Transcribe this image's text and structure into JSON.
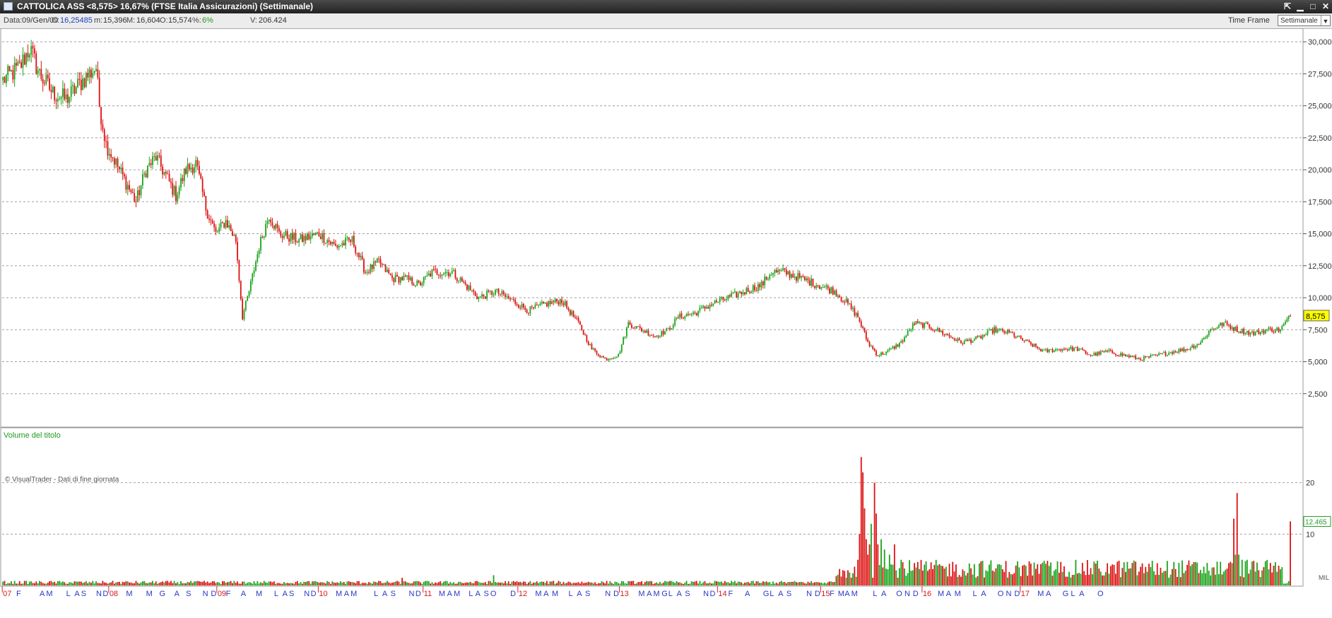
{
  "window": {
    "title": "CATTOLICA ASS <8,575> 16,67%  (FTSE Italia Assicurazioni)  (Settimanale)",
    "buttons": [
      "⇱",
      "▁",
      "□",
      "✕"
    ]
  },
  "infobar": {
    "data_label": "Data:",
    "data_value": "09/Gen/09",
    "c_label": "C:",
    "c_value": "16,25485",
    "m_label": "m:",
    "m_value": "15,396",
    "M_label": "M:",
    "M_value": "16,604",
    "o_label": "O:",
    "o_value": "15,574",
    "pct_label": "%:",
    "pct_value": "6%",
    "v_label": "V:",
    "v_value": "206.424",
    "timeframe_label": "Time Frame",
    "timeframe_value": "Settimanale"
  },
  "colors": {
    "up": "#1aa31a",
    "down": "#dd1111",
    "grid": "#a0a0a0",
    "axis_text": "#333333",
    "last_price_bg": "#ffff00"
  },
  "chart_data": [
    {
      "type": "candlestick",
      "ylim": [
        0,
        31000
      ],
      "yticks": [
        "2,500",
        "5,000",
        "7,500",
        "10,000",
        "12,500",
        "15,000",
        "17,500",
        "20,000",
        "22,500",
        "25,000",
        "27,500",
        "30,000"
      ],
      "last_price": "8,575",
      "watermark": "© VisualTrader - Dati di fine giornata",
      "grid": true,
      "anchors": [
        [
          0,
          27.0
        ],
        [
          10,
          28.0
        ],
        [
          16,
          29.5
        ],
        [
          22,
          27.5
        ],
        [
          30,
          26.0
        ],
        [
          38,
          25.5
        ],
        [
          48,
          27.0
        ],
        [
          56,
          28.0
        ],
        [
          58,
          25.0
        ],
        [
          62,
          22.0
        ],
        [
          68,
          20.5
        ],
        [
          74,
          19.0
        ],
        [
          80,
          17.5
        ],
        [
          86,
          20.0
        ],
        [
          92,
          21.0
        ],
        [
          98,
          19.5
        ],
        [
          104,
          18.0
        ],
        [
          110,
          20.0
        ],
        [
          116,
          20.5
        ],
        [
          122,
          17.0
        ],
        [
          128,
          15.0
        ],
        [
          134,
          16.0
        ],
        [
          140,
          14.5
        ],
        [
          144,
          8.5
        ],
        [
          148,
          10.5
        ],
        [
          154,
          14.0
        ],
        [
          160,
          16.5
        ],
        [
          166,
          15.0
        ],
        [
          178,
          14.5
        ],
        [
          190,
          15.0
        ],
        [
          200,
          14.0
        ],
        [
          210,
          14.5
        ],
        [
          218,
          12.0
        ],
        [
          226,
          12.8
        ],
        [
          234,
          11.5
        ],
        [
          242,
          11.5
        ],
        [
          250,
          11.0
        ],
        [
          258,
          12.0
        ],
        [
          270,
          12.0
        ],
        [
          278,
          11.0
        ],
        [
          286,
          10.0
        ],
        [
          296,
          10.5
        ],
        [
          306,
          9.8
        ],
        [
          316,
          9.0
        ],
        [
          326,
          9.5
        ],
        [
          336,
          9.8
        ],
        [
          346,
          8.0
        ],
        [
          354,
          6.0
        ],
        [
          362,
          5.2
        ],
        [
          370,
          5.5
        ],
        [
          376,
          8.0
        ],
        [
          384,
          7.5
        ],
        [
          392,
          7.0
        ],
        [
          400,
          7.5
        ],
        [
          406,
          8.5
        ],
        [
          416,
          8.8
        ],
        [
          426,
          9.5
        ],
        [
          436,
          10.0
        ],
        [
          446,
          10.5
        ],
        [
          456,
          11.0
        ],
        [
          462,
          12.0
        ],
        [
          470,
          12.0
        ],
        [
          480,
          11.5
        ],
        [
          490,
          11.0
        ],
        [
          500,
          10.5
        ],
        [
          508,
          9.5
        ],
        [
          514,
          8.5
        ],
        [
          520,
          6.5
        ],
        [
          526,
          5.5
        ],
        [
          532,
          5.8
        ],
        [
          540,
          6.5
        ],
        [
          548,
          8.0
        ],
        [
          556,
          7.8
        ],
        [
          566,
          7.2
        ],
        [
          576,
          6.5
        ],
        [
          586,
          6.8
        ],
        [
          596,
          7.5
        ],
        [
          606,
          7.2
        ],
        [
          616,
          6.5
        ],
        [
          626,
          5.8
        ],
        [
          636,
          6.0
        ],
        [
          646,
          6.0
        ],
        [
          654,
          5.5
        ],
        [
          664,
          5.8
        ],
        [
          674,
          5.5
        ],
        [
          684,
          5.2
        ],
        [
          694,
          5.5
        ],
        [
          704,
          5.8
        ],
        [
          712,
          6.0
        ],
        [
          720,
          6.5
        ],
        [
          726,
          7.5
        ],
        [
          734,
          8.0
        ],
        [
          742,
          7.5
        ],
        [
          752,
          7.2
        ],
        [
          760,
          7.5
        ],
        [
          768,
          7.5
        ],
        [
          774,
          8.575
        ]
      ],
      "x_labels": [
        {
          "t": "07",
          "r": 0,
          "c": "red"
        },
        {
          "t": "F",
          "r": 8,
          "c": "blue"
        },
        {
          "t": "A",
          "r": 22,
          "c": "blue"
        },
        {
          "t": "M",
          "r": 26,
          "c": "blue"
        },
        {
          "t": "L",
          "r": 38,
          "c": "blue"
        },
        {
          "t": "A",
          "r": 43,
          "c": "blue"
        },
        {
          "t": "S",
          "r": 47,
          "c": "blue"
        },
        {
          "t": "N",
          "r": 56,
          "c": "blue"
        },
        {
          "t": "D",
          "r": 60,
          "c": "blue"
        },
        {
          "t": "08",
          "r": 64,
          "c": "red"
        },
        {
          "t": "M",
          "r": 74,
          "c": "blue"
        },
        {
          "t": "M",
          "r": 86,
          "c": "blue"
        },
        {
          "t": "G",
          "r": 94,
          "c": "blue"
        },
        {
          "t": "A",
          "r": 103,
          "c": "blue"
        },
        {
          "t": "S",
          "r": 110,
          "c": "blue"
        },
        {
          "t": "N",
          "r": 120,
          "c": "blue"
        },
        {
          "t": "D",
          "r": 125,
          "c": "blue"
        },
        {
          "t": "09",
          "r": 129,
          "c": "red"
        },
        {
          "t": "F",
          "r": 134,
          "c": "blue"
        },
        {
          "t": "A",
          "r": 143,
          "c": "blue"
        },
        {
          "t": "M",
          "r": 152,
          "c": "blue"
        },
        {
          "t": "L",
          "r": 163,
          "c": "blue"
        },
        {
          "t": "A",
          "r": 168,
          "c": "blue"
        },
        {
          "t": "S",
          "r": 172,
          "c": "blue"
        },
        {
          "t": "N",
          "r": 181,
          "c": "blue"
        },
        {
          "t": "D",
          "r": 185,
          "c": "blue"
        },
        {
          "t": "10",
          "r": 190,
          "c": "red"
        },
        {
          "t": "M",
          "r": 200,
          "c": "blue"
        },
        {
          "t": "A",
          "r": 205,
          "c": "blue"
        },
        {
          "t": "M",
          "r": 209,
          "c": "blue"
        },
        {
          "t": "L",
          "r": 223,
          "c": "blue"
        },
        {
          "t": "A",
          "r": 228,
          "c": "blue"
        },
        {
          "t": "S",
          "r": 233,
          "c": "blue"
        },
        {
          "t": "N",
          "r": 244,
          "c": "blue"
        },
        {
          "t": "D",
          "r": 248,
          "c": "blue"
        },
        {
          "t": "11",
          "r": 253,
          "c": "red"
        },
        {
          "t": "M",
          "r": 262,
          "c": "blue"
        },
        {
          "t": "A",
          "r": 267,
          "c": "blue"
        },
        {
          "t": "M",
          "r": 271,
          "c": "blue"
        },
        {
          "t": "L",
          "r": 280,
          "c": "blue"
        },
        {
          "t": "A",
          "r": 284,
          "c": "blue"
        },
        {
          "t": "S",
          "r": 289,
          "c": "blue"
        },
        {
          "t": "O",
          "r": 293,
          "c": "blue"
        },
        {
          "t": "D",
          "r": 305,
          "c": "blue"
        },
        {
          "t": "12",
          "r": 310,
          "c": "red"
        },
        {
          "t": "M",
          "r": 320,
          "c": "blue"
        },
        {
          "t": "A",
          "r": 325,
          "c": "blue"
        },
        {
          "t": "M",
          "r": 330,
          "c": "blue"
        },
        {
          "t": "L",
          "r": 340,
          "c": "blue"
        },
        {
          "t": "A",
          "r": 345,
          "c": "blue"
        },
        {
          "t": "S",
          "r": 350,
          "c": "blue"
        },
        {
          "t": "N",
          "r": 362,
          "c": "blue"
        },
        {
          "t": "D",
          "r": 367,
          "c": "blue"
        },
        {
          "t": "13",
          "r": 371,
          "c": "red"
        },
        {
          "t": "M",
          "r": 382,
          "c": "blue"
        },
        {
          "t": "A",
          "r": 387,
          "c": "blue"
        },
        {
          "t": "M",
          "r": 391,
          "c": "blue"
        },
        {
          "t": "G",
          "r": 396,
          "c": "blue"
        },
        {
          "t": "L",
          "r": 400,
          "c": "blue"
        },
        {
          "t": "A",
          "r": 405,
          "c": "blue"
        },
        {
          "t": "S",
          "r": 410,
          "c": "blue"
        },
        {
          "t": "N",
          "r": 421,
          "c": "blue"
        },
        {
          "t": "D",
          "r": 425,
          "c": "blue"
        },
        {
          "t": "14",
          "r": 430,
          "c": "red"
        },
        {
          "t": "F",
          "r": 436,
          "c": "blue"
        },
        {
          "t": "A",
          "r": 446,
          "c": "blue"
        },
        {
          "t": "G",
          "r": 457,
          "c": "blue"
        },
        {
          "t": "L",
          "r": 461,
          "c": "blue"
        },
        {
          "t": "A",
          "r": 466,
          "c": "blue"
        },
        {
          "t": "S",
          "r": 471,
          "c": "blue"
        },
        {
          "t": "N",
          "r": 483,
          "c": "blue"
        },
        {
          "t": "D",
          "r": 488,
          "c": "blue"
        },
        {
          "t": "15",
          "r": 492,
          "c": "red"
        },
        {
          "t": "F",
          "r": 497,
          "c": "blue"
        },
        {
          "t": "M",
          "r": 502,
          "c": "blue"
        },
        {
          "t": "A",
          "r": 506,
          "c": "blue"
        },
        {
          "t": "M",
          "r": 510,
          "c": "blue"
        },
        {
          "t": "L",
          "r": 523,
          "c": "blue"
        },
        {
          "t": "A",
          "r": 528,
          "c": "blue"
        },
        {
          "t": "O",
          "r": 537,
          "c": "blue"
        },
        {
          "t": "N",
          "r": 542,
          "c": "blue"
        },
        {
          "t": "D",
          "r": 547,
          "c": "blue"
        },
        {
          "t": "16",
          "r": 553,
          "c": "red"
        },
        {
          "t": "M",
          "r": 562,
          "c": "blue"
        },
        {
          "t": "A",
          "r": 567,
          "c": "blue"
        },
        {
          "t": "M",
          "r": 572,
          "c": "blue"
        },
        {
          "t": "L",
          "r": 583,
          "c": "blue"
        },
        {
          "t": "A",
          "r": 588,
          "c": "blue"
        },
        {
          "t": "O",
          "r": 598,
          "c": "blue"
        },
        {
          "t": "N",
          "r": 603,
          "c": "blue"
        },
        {
          "t": "D",
          "r": 608,
          "c": "blue"
        },
        {
          "t": "17",
          "r": 612,
          "c": "red"
        },
        {
          "t": "M",
          "r": 622,
          "c": "blue"
        },
        {
          "t": "A",
          "r": 627,
          "c": "blue"
        },
        {
          "t": "G",
          "r": 637,
          "c": "blue"
        },
        {
          "t": "L",
          "r": 642,
          "c": "blue"
        },
        {
          "t": "A",
          "r": 647,
          "c": "blue"
        },
        {
          "t": "O",
          "r": 658,
          "c": "blue"
        }
      ]
    },
    {
      "type": "bar",
      "title": "Volume del titolo",
      "ylim": [
        0,
        30
      ],
      "yticks": [
        "10",
        "20"
      ],
      "unit": "MIL",
      "last_value": "12.465",
      "baseline_volume": 0.7,
      "spikes": [
        {
          "r": 514,
          "v": 5
        },
        {
          "r": 515,
          "v": 10
        },
        {
          "r": 516,
          "v": 25
        },
        {
          "r": 517,
          "v": 22
        },
        {
          "r": 518,
          "v": 15
        },
        {
          "r": 519,
          "v": 9
        },
        {
          "r": 520,
          "v": 6
        },
        {
          "r": 521,
          "v": 8
        },
        {
          "r": 522,
          "v": 12
        },
        {
          "r": 524,
          "v": 20
        },
        {
          "r": 525,
          "v": 14
        },
        {
          "r": 526,
          "v": 8
        },
        {
          "r": 528,
          "v": 9
        },
        {
          "r": 530,
          "v": 7
        },
        {
          "r": 533,
          "v": 6
        },
        {
          "r": 536,
          "v": 8
        },
        {
          "r": 540,
          "v": 5
        },
        {
          "r": 560,
          "v": 4
        },
        {
          "r": 600,
          "v": 4
        },
        {
          "r": 740,
          "v": 13
        },
        {
          "r": 741,
          "v": 6
        },
        {
          "r": 742,
          "v": 18
        },
        {
          "r": 743,
          "v": 6
        },
        {
          "r": 745,
          "v": 5
        },
        {
          "r": 748,
          "v": 5
        },
        {
          "r": 774,
          "v": 12.465
        },
        {
          "r": 295,
          "v": 2
        },
        {
          "r": 240,
          "v": 1.5
        }
      ]
    }
  ]
}
